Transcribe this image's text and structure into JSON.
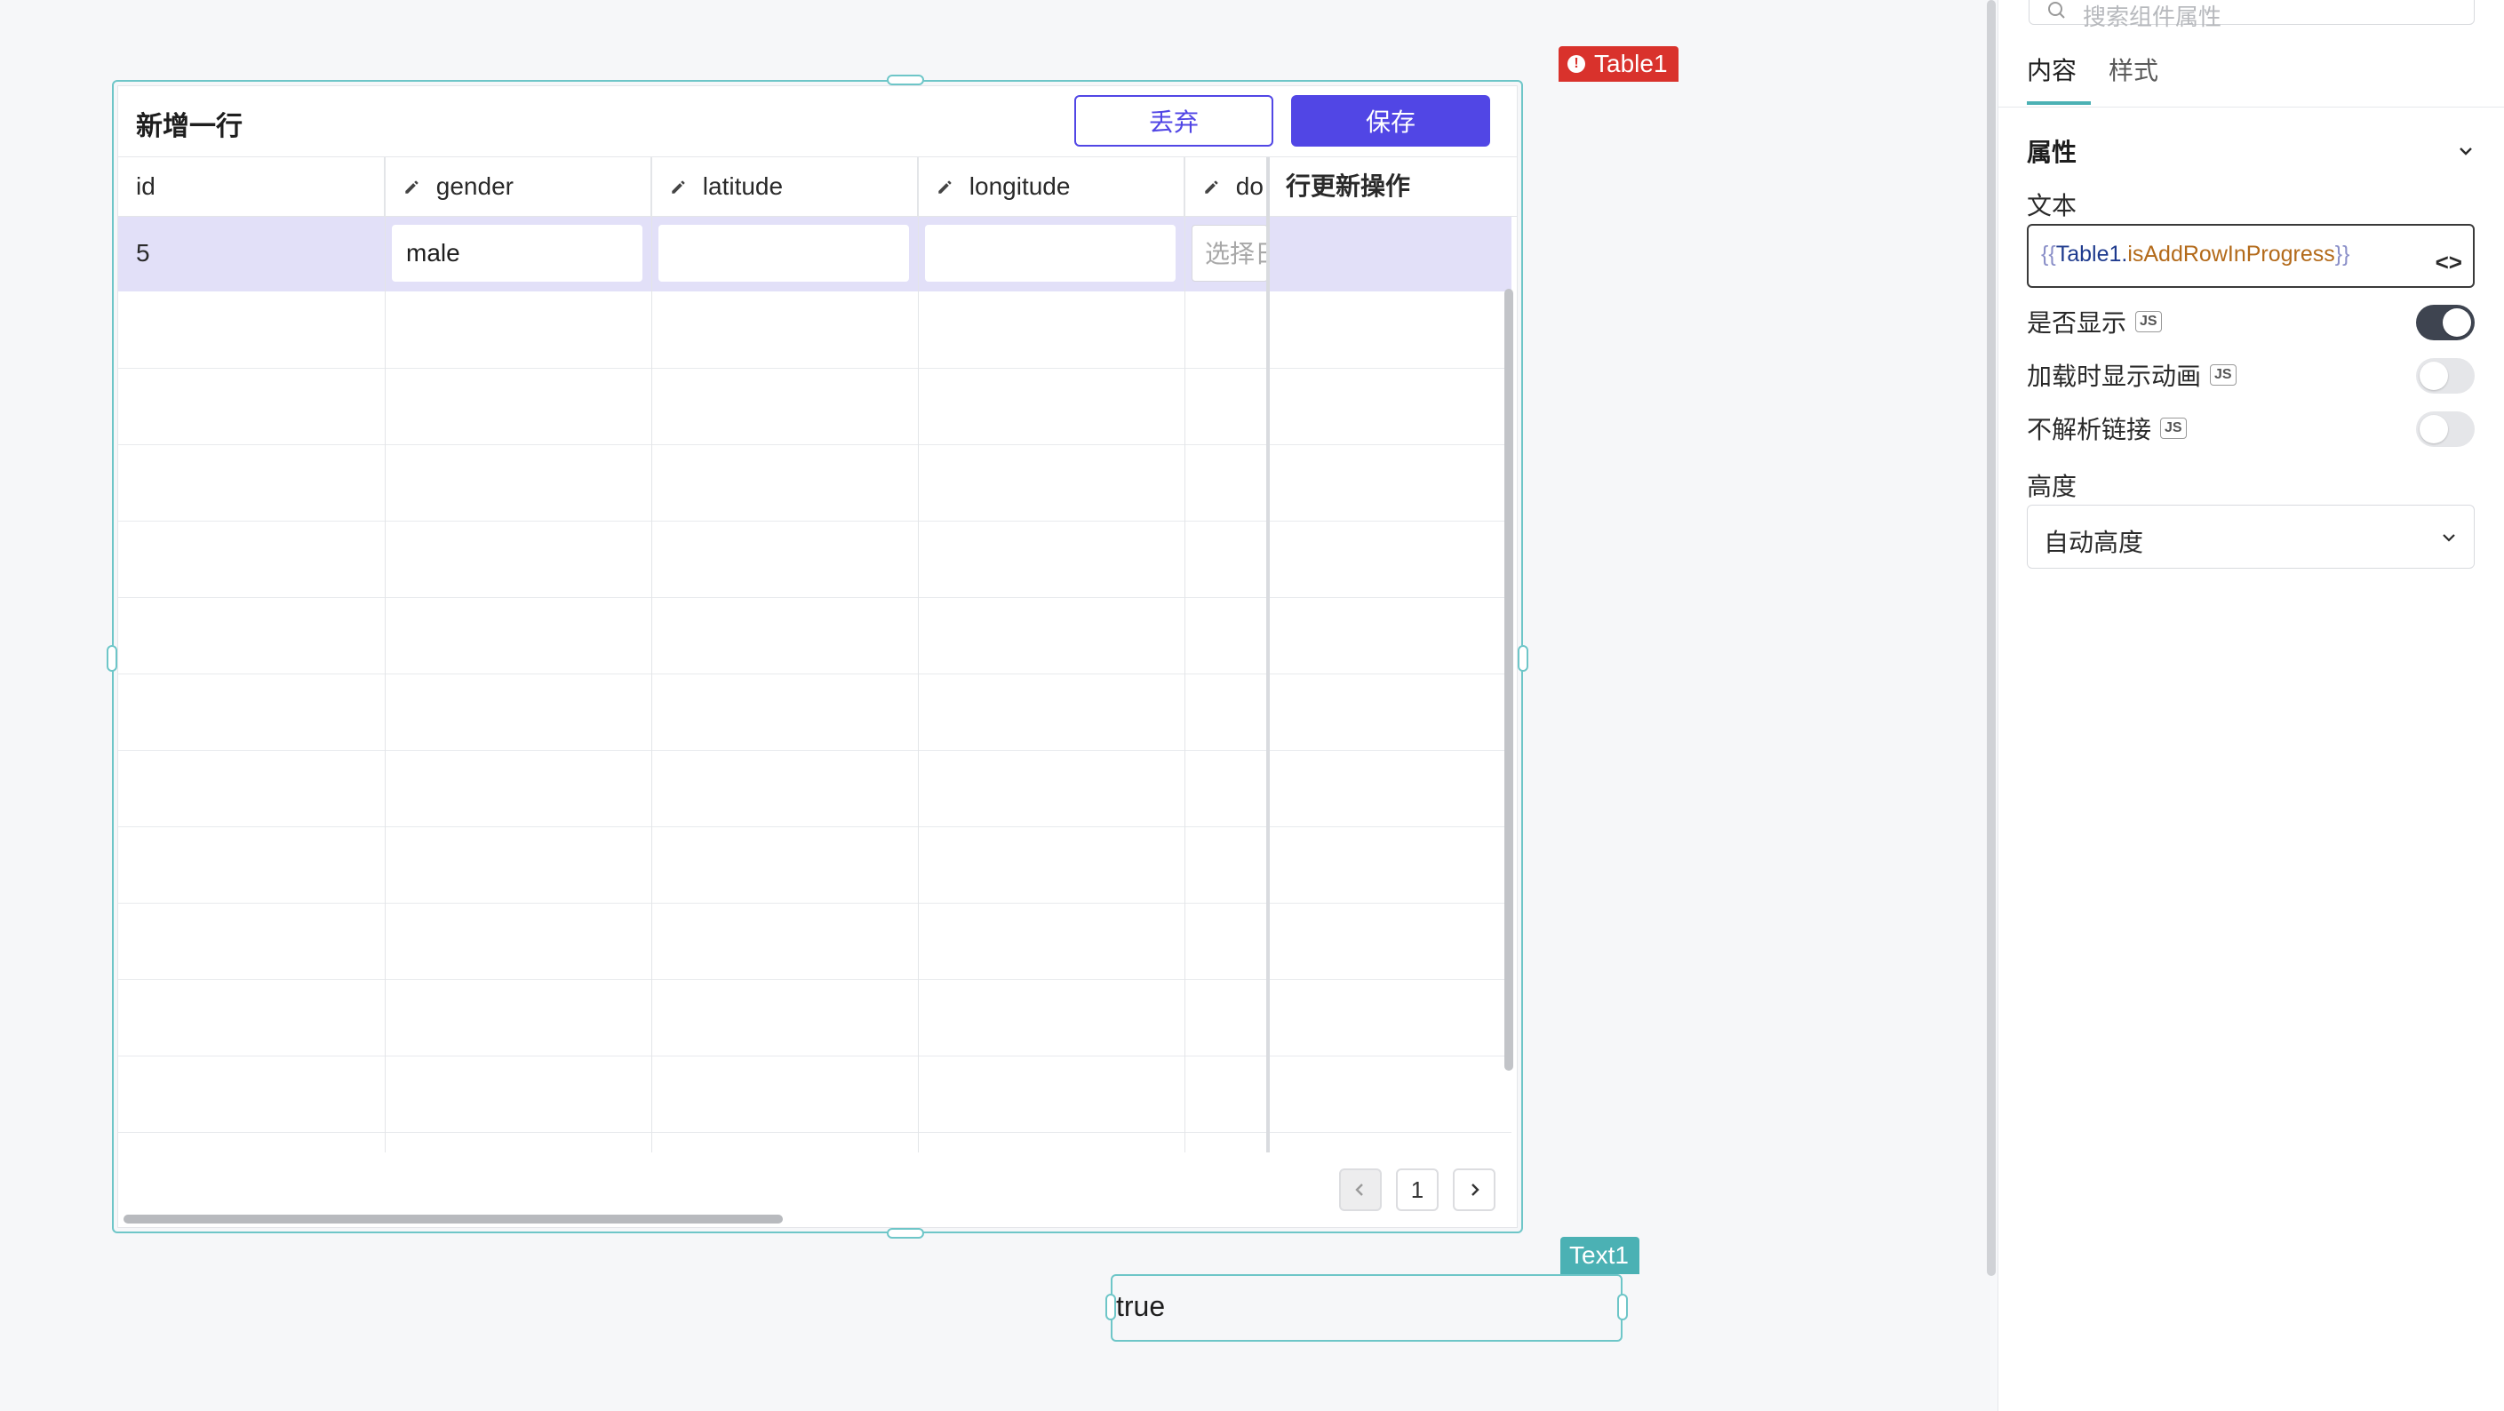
{
  "canvas": {
    "table_widget": {
      "name_tag": "Table1",
      "toolbar": {
        "title": "新增一行",
        "discard_label": "丢弃",
        "save_label": "保存"
      },
      "columns": [
        {
          "label": "id",
          "editable": false
        },
        {
          "label": "gender",
          "editable": true
        },
        {
          "label": "latitude",
          "editable": true
        },
        {
          "label": "longitude",
          "editable": true
        },
        {
          "label": "do",
          "editable": true
        },
        {
          "label": "行更新操作",
          "editable": false
        }
      ],
      "new_row": {
        "id": "5",
        "gender": "male",
        "latitude": "",
        "longitude": "",
        "do_placeholder": "选择日"
      },
      "empty_rows": 11,
      "pagination": {
        "current_page": "1"
      }
    },
    "text_widget": {
      "name_tag": "Text1",
      "value": "true"
    }
  },
  "panel": {
    "search_placeholder": "搜索组件属性",
    "tabs": [
      {
        "label": "内容",
        "active": true
      },
      {
        "label": "样式",
        "active": false
      }
    ],
    "section": "属性",
    "text_field": {
      "label": "文本",
      "open_brace": "{{",
      "object": "Table1",
      "dot": ".",
      "property": "isAddRowInProgress",
      "close_brace": "}}"
    },
    "toggles": [
      {
        "label": "是否显示",
        "badge": "JS",
        "on": true
      },
      {
        "label": "加载时显示动画",
        "badge": "JS",
        "on": false
      },
      {
        "label": "不解析链接",
        "badge": "JS",
        "on": false
      }
    ],
    "height_field": {
      "label": "高度",
      "value": "自动高度"
    }
  },
  "colors": {
    "accent": "#5146e5",
    "selection": "#6ec6c8",
    "error_tag": "#d9322c",
    "text_tag": "#4bb1b4",
    "new_row_bg": "#e2e0f8"
  }
}
